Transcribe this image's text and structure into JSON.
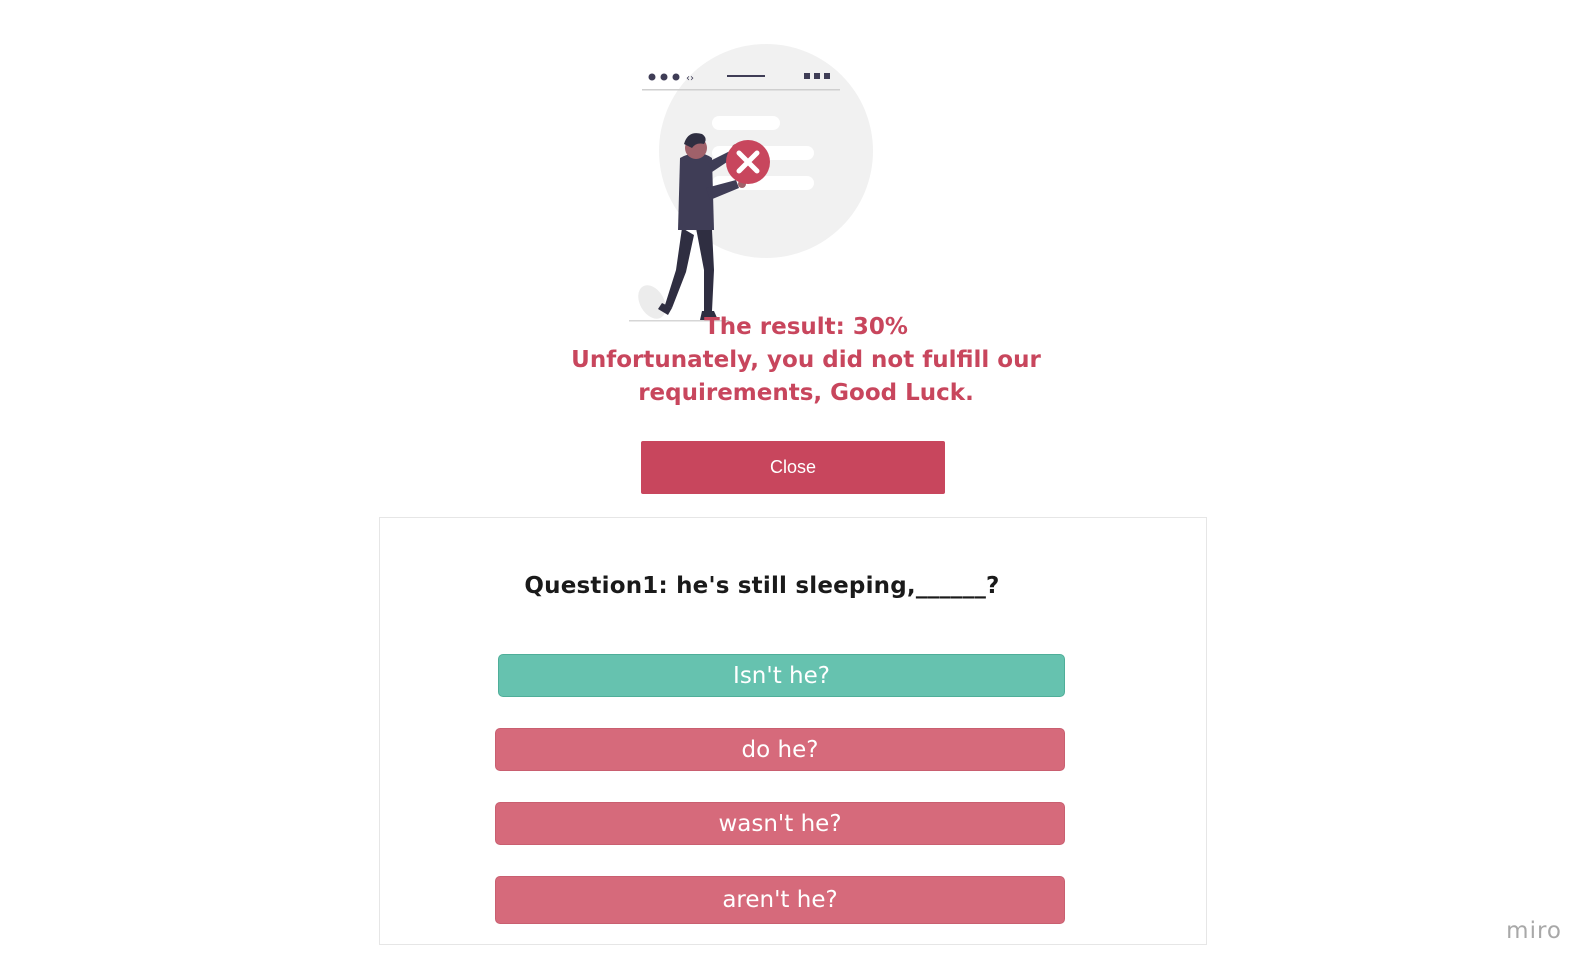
{
  "result": {
    "score_line": "The result: 30%",
    "message_line1": "Unfortunately, you did not fulfill our",
    "message_line2": "requirements, Good Luck."
  },
  "close_button": {
    "label": "Close"
  },
  "quiz": {
    "question": "Question1: he's still sleeping,______?",
    "answers": [
      {
        "label": "Isn't he?",
        "status": "correct"
      },
      {
        "label": "do he?",
        "status": "wrong"
      },
      {
        "label": "wasn't he?",
        "status": "wrong"
      },
      {
        "label": "aren't he?",
        "status": "wrong"
      }
    ]
  },
  "watermark": {
    "text": "miro"
  },
  "colors": {
    "accent_red": "#c8465d",
    "correct_green": "#66c2af",
    "wrong_pink": "#d66a7b"
  },
  "illustration": {
    "icon": "failed-result-illustration"
  }
}
